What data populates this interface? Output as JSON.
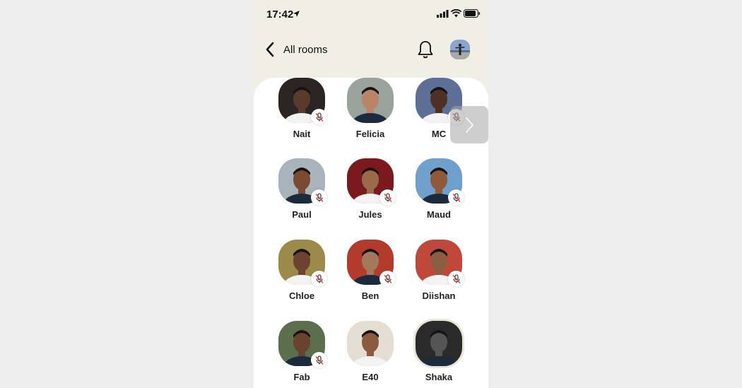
{
  "status_bar": {
    "time": "17:42"
  },
  "header": {
    "back_label": "All rooms"
  },
  "participants": [
    {
      "name": "Nait",
      "muted": true,
      "skin": "#5a3a2a",
      "bg": "#2b2624"
    },
    {
      "name": "Felicia",
      "muted": false,
      "skin": "#b98468",
      "bg": "#9aa29c"
    },
    {
      "name": "MC",
      "muted": true,
      "skin": "#4e3124",
      "bg": "#5d6f97"
    },
    {
      "name": "Paul",
      "muted": true,
      "skin": "#7a4b32",
      "bg": "#a9b3bb"
    },
    {
      "name": "Jules",
      "muted": true,
      "skin": "#9a6a4c",
      "bg": "#7a1a1e"
    },
    {
      "name": "Maud",
      "muted": true,
      "skin": "#8f5a3a",
      "bg": "#6f9fcd"
    },
    {
      "name": "Chloe",
      "muted": true,
      "skin": "#6b4330",
      "bg": "#9c8a4a"
    },
    {
      "name": "Ben",
      "muted": true,
      "skin": "#a3785c",
      "bg": "#b23b2c"
    },
    {
      "name": "Diishan",
      "muted": true,
      "skin": "#8b5e44",
      "bg": "#c0483a"
    },
    {
      "name": "Fab",
      "muted": true,
      "skin": "#6a4230",
      "bg": "#5b6f4c"
    },
    {
      "name": "E40",
      "muted": false,
      "skin": "#8a5b3f",
      "bg": "#e3ddd4"
    },
    {
      "name": "Shaka",
      "muted": false,
      "skin": "#555555",
      "bg": "#2a2a2a"
    }
  ],
  "colors": {
    "mute_red": "#d94a3a",
    "sheet": "#ffffff",
    "header_bg": "#f1efe5"
  }
}
